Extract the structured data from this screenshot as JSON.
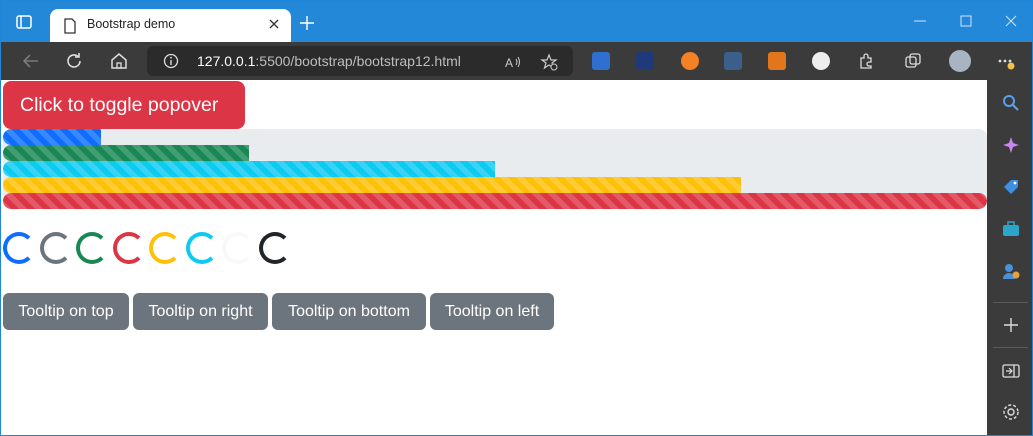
{
  "browser": {
    "tab_title": "Bootstrap demo",
    "url_host": "127.0.0.1",
    "url_rest": ":5500/bootstrap/bootstrap12.html",
    "colors": {
      "titlebar": "#2488d8",
      "toolbar": "#3b3b3b"
    }
  },
  "page": {
    "popover_button": "Click to toggle popover",
    "progress": [
      {
        "name": "blue",
        "color": "#0d6efd",
        "percent": 10
      },
      {
        "name": "green",
        "color": "#198754",
        "percent": 25
      },
      {
        "name": "cyan",
        "color": "#0dcaf0",
        "percent": 50
      },
      {
        "name": "yellow",
        "color": "#ffc107",
        "percent": 75
      },
      {
        "name": "red",
        "color": "#dc3545",
        "percent": 100
      }
    ],
    "spinners": [
      {
        "name": "primary",
        "color": "#0d6efd"
      },
      {
        "name": "secondary",
        "color": "#6c757d"
      },
      {
        "name": "success",
        "color": "#198754"
      },
      {
        "name": "danger",
        "color": "#dc3545"
      },
      {
        "name": "warning",
        "color": "#ffc107"
      },
      {
        "name": "info",
        "color": "#0dcaf0"
      },
      {
        "name": "light",
        "color": "#f8f9fa"
      },
      {
        "name": "dark",
        "color": "#212529"
      }
    ],
    "tooltip_buttons": [
      "Tooltip on top",
      "Tooltip on right",
      "Tooltip on bottom",
      "Tooltip on left"
    ]
  }
}
